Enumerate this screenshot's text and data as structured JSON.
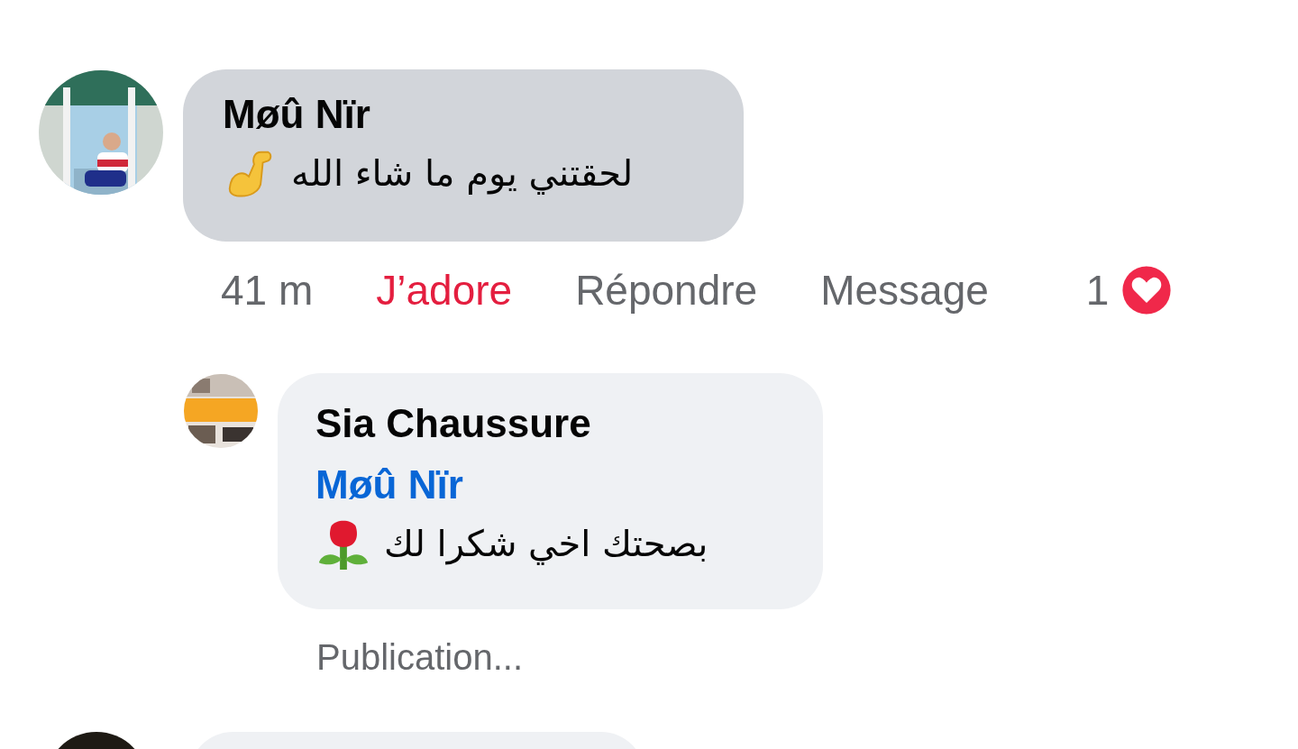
{
  "comment": {
    "author": "Møû Nïr",
    "text": "لحقتني يوم ما شاء الله"
  },
  "actions": {
    "time": "41 m",
    "like": {
      "label": "J’adore",
      "selected": true
    },
    "reply": "Répondre",
    "message": "Message",
    "reaction_count": "1"
  },
  "reply": {
    "author": "Sia Chaussure",
    "mention": "Møû Nïr",
    "text": "بصحتك اخي شكرا لك",
    "status": "Publication..."
  }
}
